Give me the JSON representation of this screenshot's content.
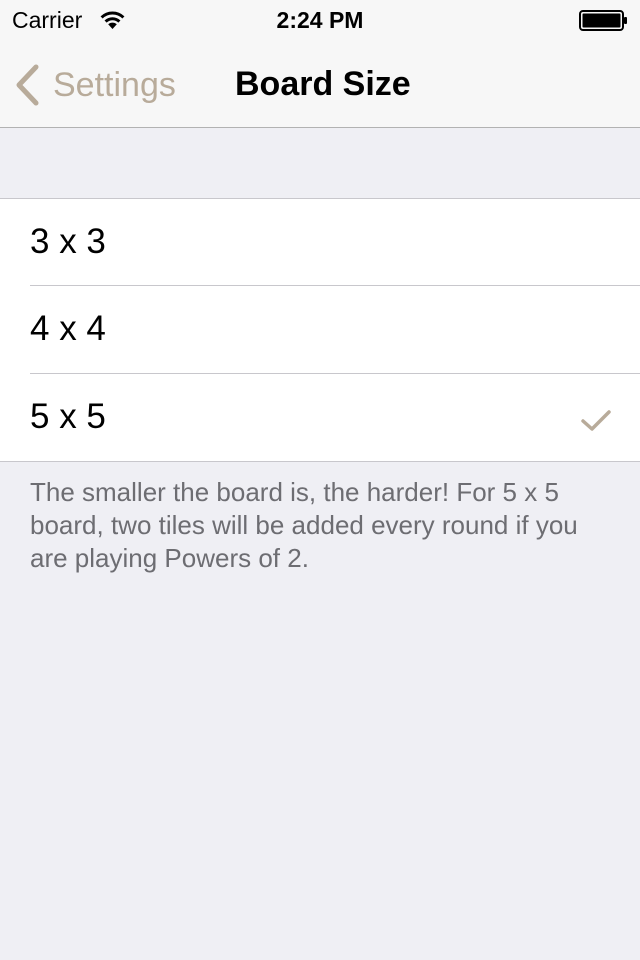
{
  "status_bar": {
    "carrier": "Carrier",
    "time": "2:24 PM"
  },
  "nav": {
    "back_label": "Settings",
    "title": "Board Size"
  },
  "options": [
    {
      "label": "3 x 3",
      "selected": false
    },
    {
      "label": "4 x 4",
      "selected": false
    },
    {
      "label": "5 x 5",
      "selected": true
    }
  ],
  "footer": "The smaller the board is, the harder! For 5 x 5 board, two tiles will be added every round if you are playing Powers of 2.",
  "colors": {
    "accent": "#b8ab9a",
    "background": "#efeff4",
    "footer_text": "#6d6d72"
  }
}
